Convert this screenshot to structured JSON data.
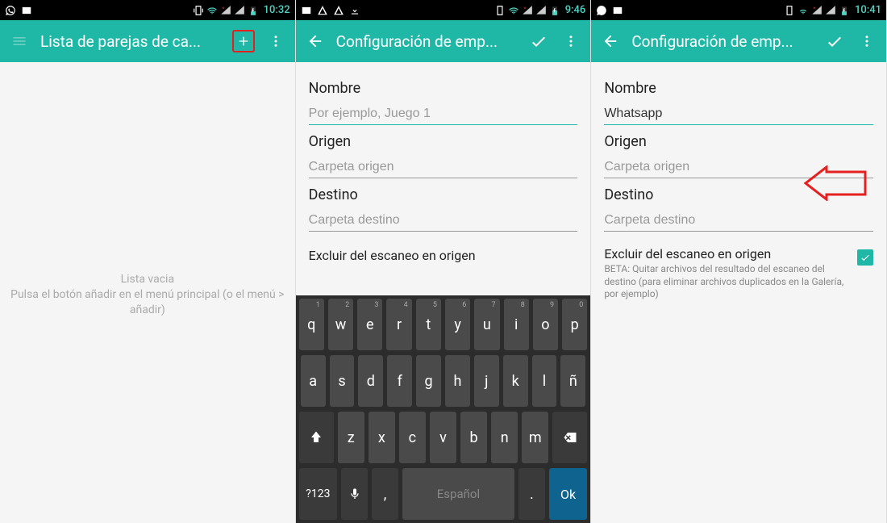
{
  "screens": {
    "s1": {
      "time": "10:32",
      "title": "Lista de parejas de ca...",
      "empty1": "Lista vacia",
      "empty2": "Pulsa el botón añadir en el menú principal (o el menú > añadir)"
    },
    "s2": {
      "time": "9:46",
      "title": "Configuración de emp...",
      "nombre_label": "Nombre",
      "nombre_placeholder": "Por ejemplo, Juego 1",
      "origen_label": "Origen",
      "origen_placeholder": "Carpeta origen",
      "destino_label": "Destino",
      "destino_placeholder": "Carpeta destino",
      "exclude_title": "Excluir del escaneo en origen"
    },
    "s3": {
      "time": "10:41",
      "title": "Configuración de emp...",
      "nombre_label": "Nombre",
      "nombre_value": "Whatsapp",
      "origen_label": "Origen",
      "origen_placeholder": "Carpeta origen",
      "destino_label": "Destino",
      "destino_placeholder": "Carpeta destino",
      "exclude_title": "Excluir del escaneo en origen",
      "exclude_desc": "BETA: Quitar archivos del resultado del escaneo del destino (para eliminar archivos duplicados en la Galería, por ejemplo)"
    },
    "keyboard": {
      "r1": [
        "q",
        "w",
        "e",
        "r",
        "t",
        "y",
        "u",
        "i",
        "o",
        "p"
      ],
      "r1sup": [
        "1",
        "2",
        "3",
        "4",
        "5",
        "6",
        "7",
        "8",
        "9",
        "0"
      ],
      "r2": [
        "a",
        "s",
        "d",
        "f",
        "g",
        "h",
        "j",
        "k",
        "l",
        "ñ"
      ],
      "r3": [
        "z",
        "x",
        "c",
        "v",
        "b",
        "n",
        "m"
      ],
      "sym": "?123",
      "space": "Español",
      "ok": "Ok",
      "comma": ",",
      "dot": "."
    }
  }
}
